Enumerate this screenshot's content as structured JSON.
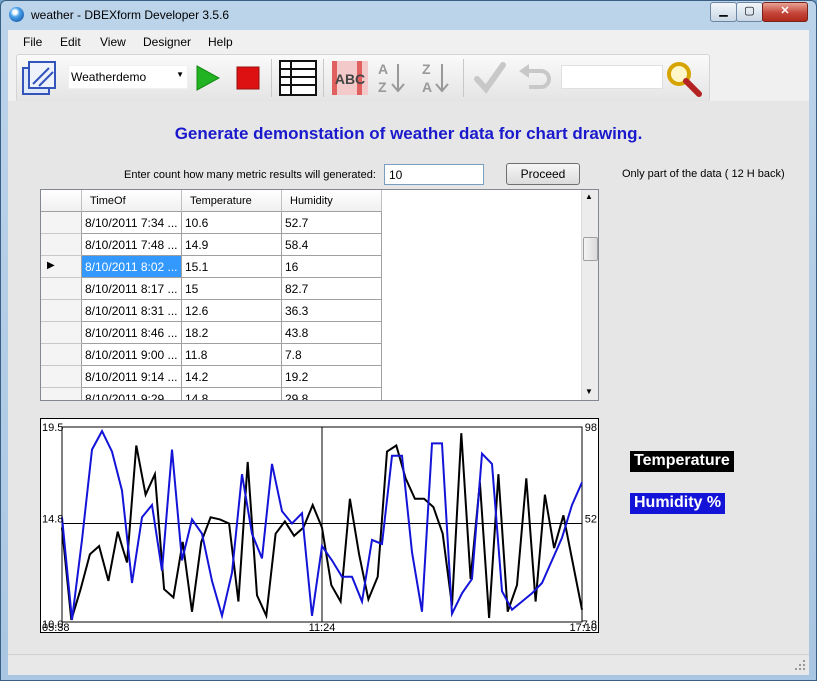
{
  "window": {
    "title": "weather - DBEXform Developer 3.5.6",
    "minimize": "▁",
    "maximize": "▢",
    "close": "✕"
  },
  "menu": [
    "File",
    "Edit",
    "View",
    "Designer",
    "Help"
  ],
  "toolbar": {
    "combo_value": "Weatherdemo",
    "combo_arrow": "▼"
  },
  "form": {
    "headline": "Generate demonstation of weather  data for chart drawing.",
    "prompt": "Enter count how many metric results will generated:",
    "count_value": "10",
    "proceed": "Proceed",
    "note": "Only part of the data ( 12 H back)"
  },
  "grid": {
    "columns": [
      "TimeOf",
      "Temperature",
      "Humidity"
    ],
    "rows": [
      [
        "8/10/2011 7:34 ...",
        "10.6",
        "52.7"
      ],
      [
        "8/10/2011 7:48 ...",
        "14.9",
        "58.4"
      ],
      [
        "8/10/2011 8:02 ...",
        "15.1",
        "16"
      ],
      [
        "8/10/2011 8:17 ...",
        "15",
        "82.7"
      ],
      [
        "8/10/2011 8:31 ...",
        "12.6",
        "36.3"
      ],
      [
        "8/10/2011 8:46 ...",
        "18.2",
        "43.8"
      ],
      [
        "8/10/2011 9:00 ...",
        "11.8",
        "7.8"
      ],
      [
        "8/10/2011 9:14 ...",
        "14.2",
        "19.2"
      ],
      [
        "8/10/2011 9:29 ...",
        "14.8",
        "29.8"
      ]
    ],
    "selected_row": 2,
    "current_marker": "▶",
    "scroll_up": "▲",
    "scroll_down": "▼"
  },
  "chart_data": {
    "type": "line",
    "left_axis": {
      "min": 10.0,
      "max": 19.5,
      "mid": 14.8
    },
    "right_axis": {
      "min": 7.8,
      "max": 98,
      "mid": 52
    },
    "left_labels": {
      "top": "19.5",
      "mid": "14.8",
      "bottom": "10.0"
    },
    "right_labels": {
      "top": "98",
      "mid": "52",
      "bottom": "7.8"
    },
    "x_labels": [
      "05:38",
      "11:24",
      "17:10"
    ],
    "series": [
      {
        "name": "Temperature",
        "color": "#000000",
        "axis": "left",
        "values": [
          14.6,
          10.1,
          11.6,
          13.3,
          13.7,
          12.0,
          14.4,
          12.9,
          18.6,
          16.2,
          17.2,
          11.6,
          11.2,
          13.9,
          10.5,
          13.9,
          15.1,
          15.0,
          14.8,
          11.0,
          17.8,
          11.3,
          10.3,
          14.3,
          14.9,
          14.2,
          14.6,
          15.7,
          14.6,
          11.8,
          11.0,
          16.0,
          13.3,
          11.1,
          12.2,
          18.3,
          18.6,
          17.0,
          16.0,
          16.0,
          15.6,
          14.3,
          10.8,
          19.2,
          12.1,
          16.8,
          10.2,
          17.2,
          10.5,
          11.8,
          17.0,
          11.0,
          16.2,
          13.6,
          15.2,
          12.9,
          10.6
        ]
      },
      {
        "name": "Humidity %",
        "color": "#1414d8",
        "axis": "left",
        "values": [
          15.1,
          10.1,
          14.0,
          18.4,
          19.3,
          18.3,
          16.4,
          11.9,
          15.1,
          15.7,
          12.5,
          18.4,
          13.0,
          15.0,
          14.3,
          12.0,
          10.3,
          12.4,
          17.2,
          14.3,
          13.1,
          17.7,
          15.4,
          14.8,
          15.3,
          10.3,
          13.7,
          13.0,
          12.2,
          12.2,
          11.0,
          14.0,
          13.8,
          18.1,
          18.1,
          13.4,
          10.5,
          18.7,
          18.7,
          10.4,
          11.4,
          12.1,
          18.2,
          17.7,
          11.5,
          10.6,
          11.0,
          11.4,
          11.9,
          13.0,
          14.1,
          15.7,
          16.8
        ]
      }
    ],
    "grid": true
  }
}
